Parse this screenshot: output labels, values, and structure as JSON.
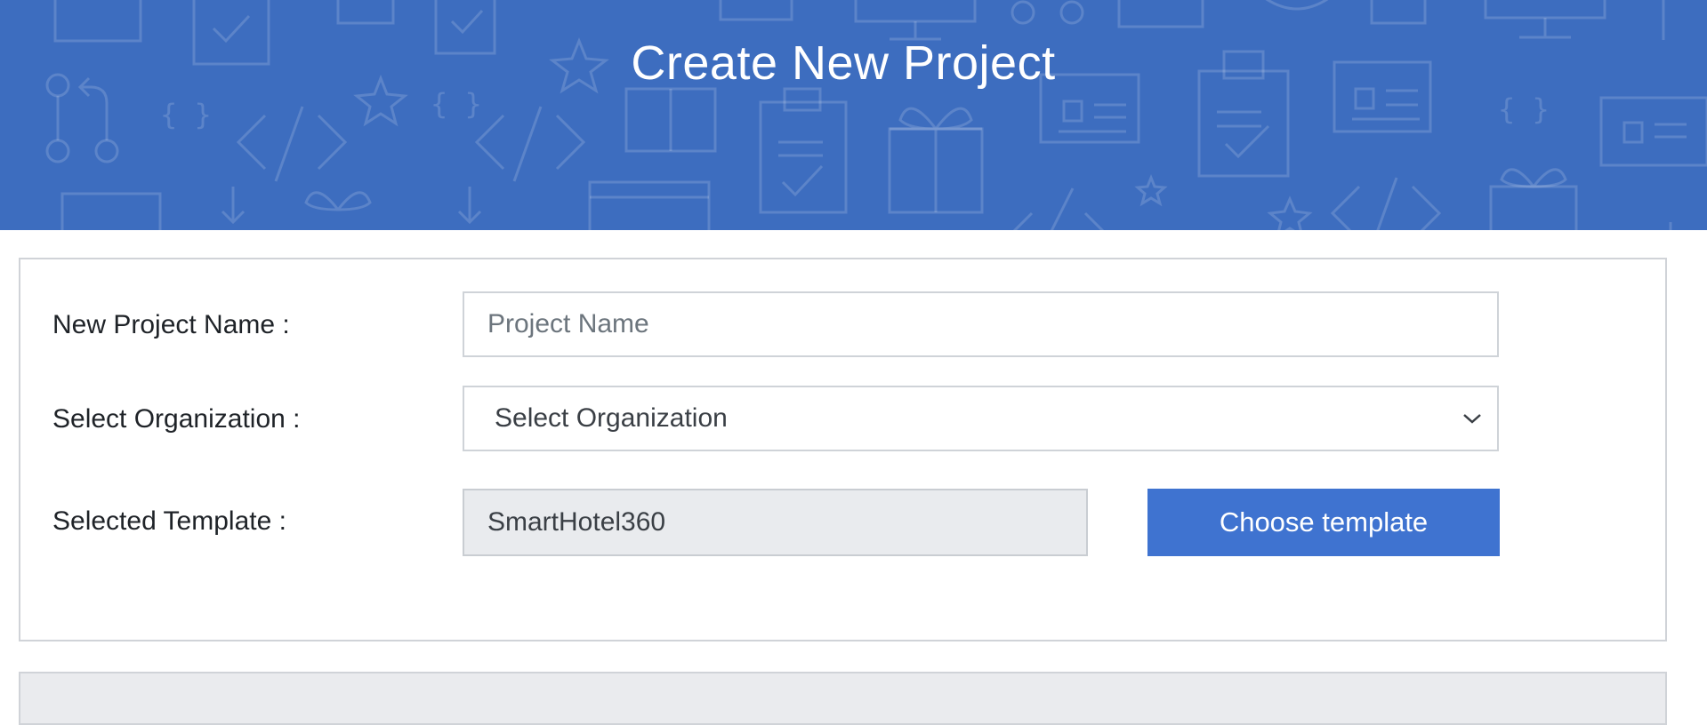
{
  "header": {
    "title": "Create New Project",
    "background_color": "#3d6dbf"
  },
  "form": {
    "project_name": {
      "label": "New Project Name :",
      "placeholder": "Project Name",
      "value": ""
    },
    "organization": {
      "label": "Select Organization :",
      "selected": "Select Organization"
    },
    "template": {
      "label": "Selected Template :",
      "value": "SmartHotel360",
      "button_label": "Choose template",
      "button_color": "#3f73d0"
    }
  },
  "icons": {
    "select_chevron": "chevron-down-icon",
    "background_pattern": "devops-pattern-icons"
  }
}
